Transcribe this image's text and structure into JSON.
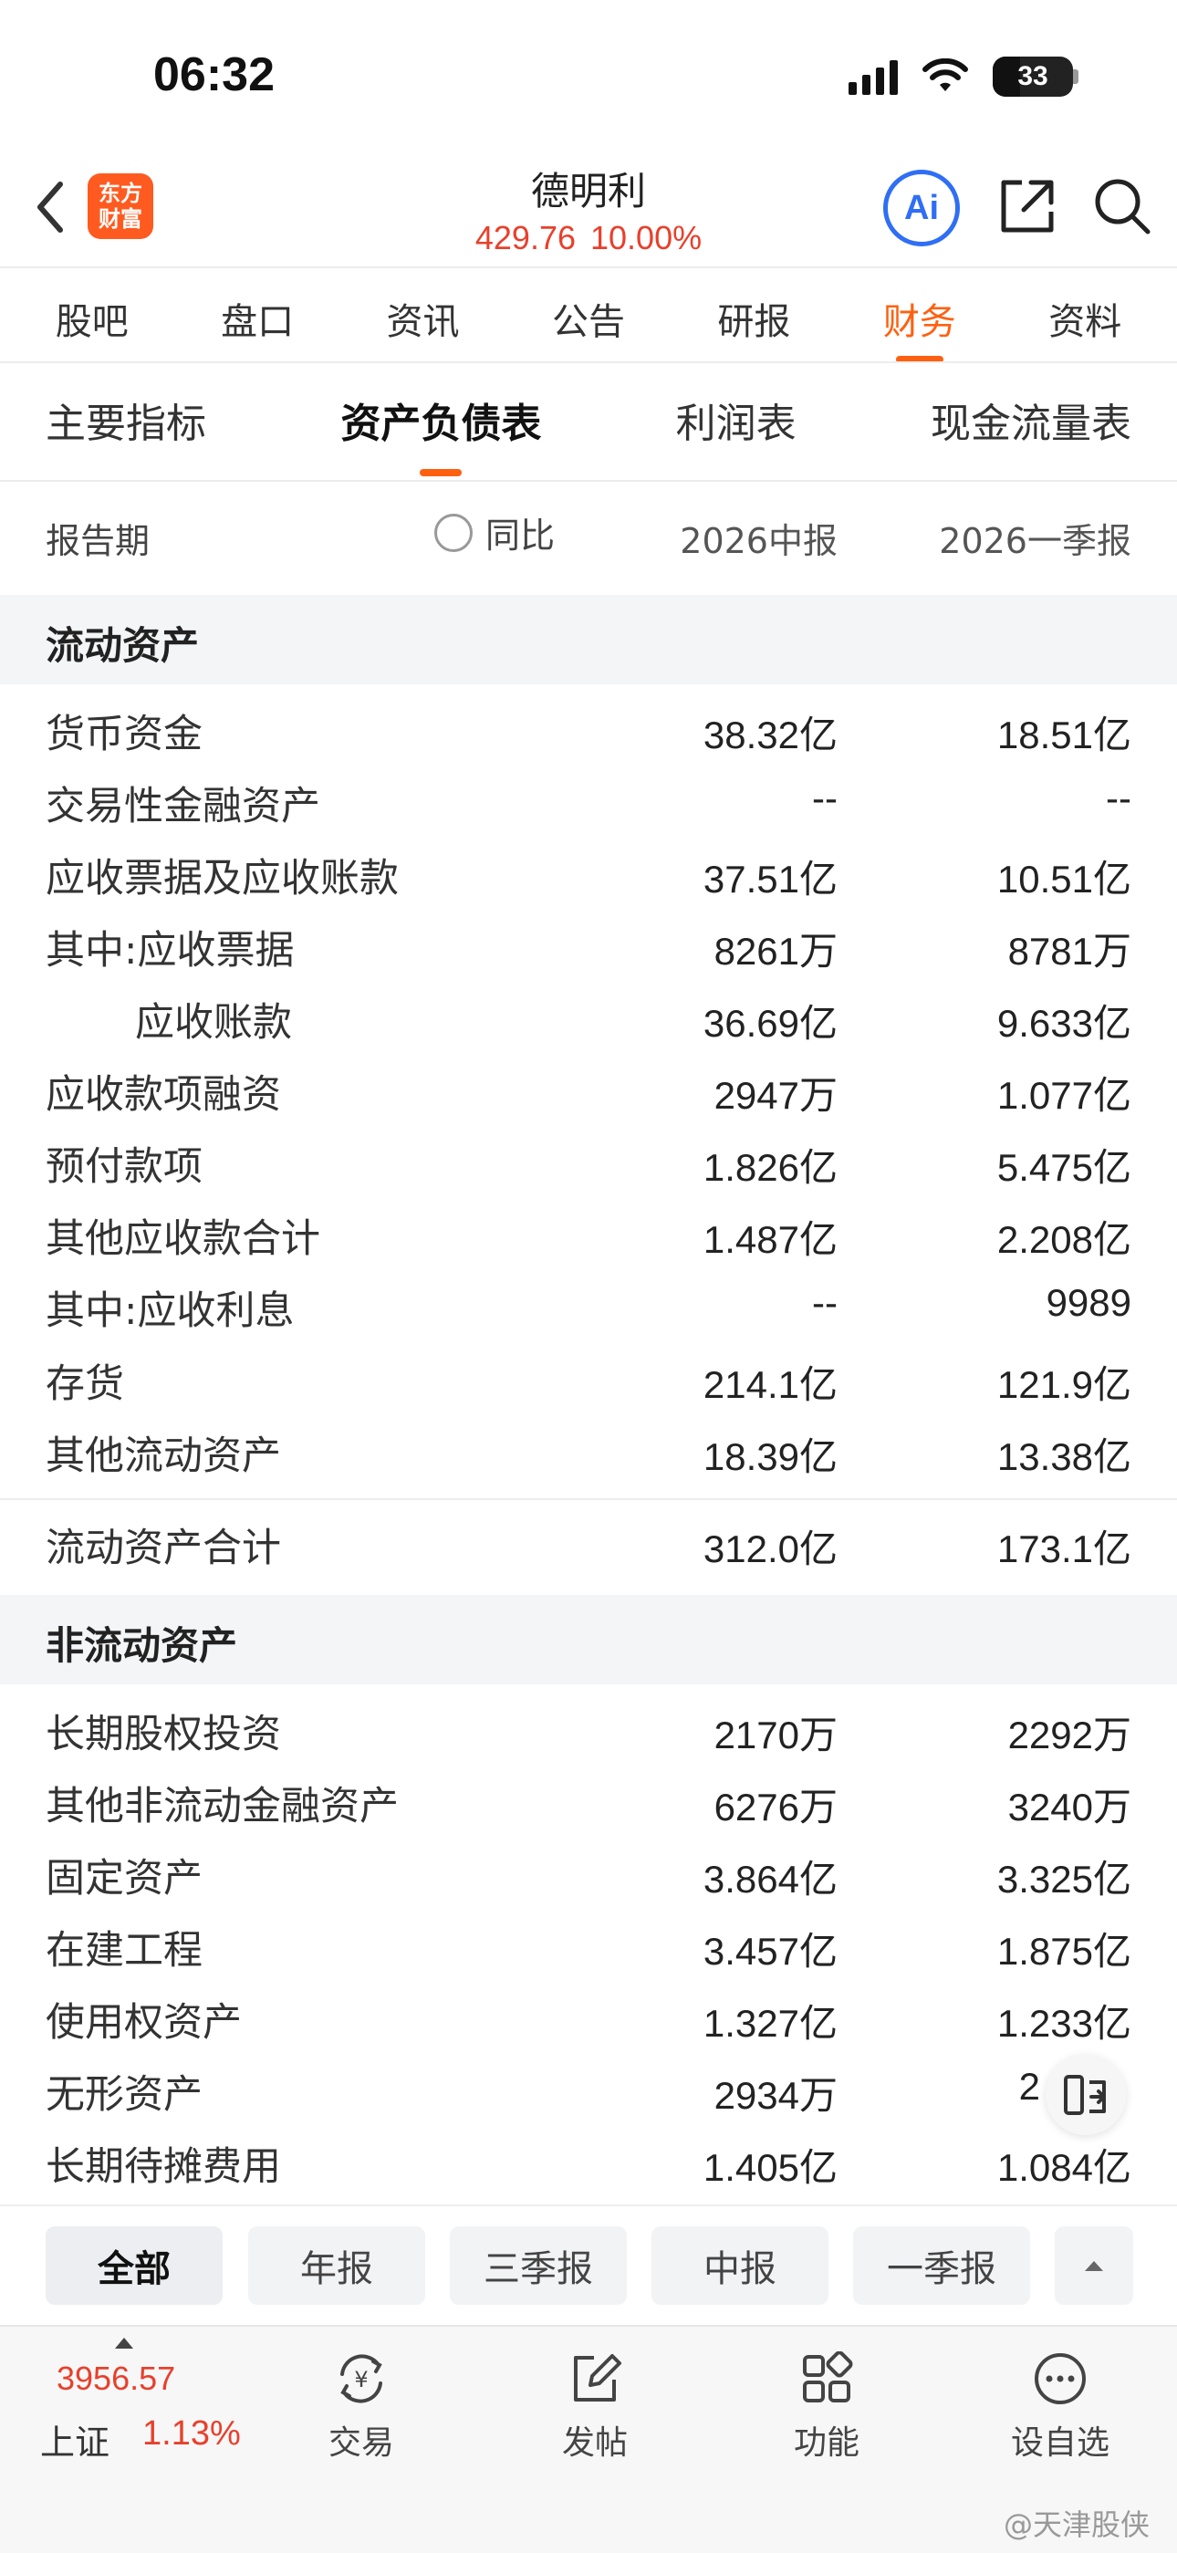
{
  "status": {
    "time": "06:32",
    "battery": "33"
  },
  "header": {
    "logo_line1": "东方",
    "logo_line2": "财富",
    "title": "德明利",
    "price": "429.76",
    "change_pct": "10.00%",
    "ai_label": "Ai"
  },
  "tabs": [
    "股吧",
    "盘口",
    "资讯",
    "公告",
    "研报",
    "财务",
    "资料"
  ],
  "active_tab": "财务",
  "subtabs": [
    "主要指标",
    "资产负债表",
    "利润表",
    "现金流量表"
  ],
  "active_subtab": "资产负债表",
  "table_header": {
    "period_label": "报告期",
    "yoy_label": "同比",
    "col1": "2026中报",
    "col2": "2026一季报"
  },
  "sections": [
    {
      "title": "流动资产",
      "rows": [
        {
          "label": "货币资金",
          "v1": "38.32亿",
          "v2": "18.51亿"
        },
        {
          "label": "交易性金融资产",
          "v1": "--",
          "v2": "--"
        },
        {
          "label": "应收票据及应收账款",
          "v1": "37.51亿",
          "v2": "10.51亿"
        },
        {
          "label": "其中:应收票据",
          "v1": "8261万",
          "v2": "8781万"
        },
        {
          "label": "应收账款",
          "v1": "36.69亿",
          "v2": "9.633亿",
          "indent": true
        },
        {
          "label": "应收款项融资",
          "v1": "2947万",
          "v2": "1.077亿"
        },
        {
          "label": "预付款项",
          "v1": "1.826亿",
          "v2": "5.475亿"
        },
        {
          "label": "其他应收款合计",
          "v1": "1.487亿",
          "v2": "2.208亿"
        },
        {
          "label": "其中:应收利息",
          "v1": "--",
          "v2": "9989"
        },
        {
          "label": "存货",
          "v1": "214.1亿",
          "v2": "121.9亿"
        },
        {
          "label": "其他流动资产",
          "v1": "18.39亿",
          "v2": "13.38亿"
        }
      ],
      "total": {
        "label": "流动资产合计",
        "v1": "312.0亿",
        "v2": "173.1亿"
      }
    },
    {
      "title": "非流动资产",
      "rows": [
        {
          "label": "长期股权投资",
          "v1": "2170万",
          "v2": "2292万"
        },
        {
          "label": "其他非流动金融资产",
          "v1": "6276万",
          "v2": "3240万"
        },
        {
          "label": "固定资产",
          "v1": "3.864亿",
          "v2": "3.325亿"
        },
        {
          "label": "在建工程",
          "v1": "3.457亿",
          "v2": "1.875亿"
        },
        {
          "label": "使用权资产",
          "v1": "1.327亿",
          "v2": "1.233亿"
        },
        {
          "label": "无形资产",
          "v1": "2934万",
          "v2": "2"
        },
        {
          "label": "长期待摊费用",
          "v1": "1.405亿",
          "v2": "1.084亿"
        }
      ]
    }
  ],
  "filters": [
    "全部",
    "年报",
    "三季报",
    "中报",
    "一季报"
  ],
  "active_filter": "全部",
  "index": {
    "value": "3956.57",
    "name": "上证",
    "pct": "1.13%"
  },
  "nav": [
    {
      "label": "交易",
      "icon": "yuan-exchange-icon"
    },
    {
      "label": "发帖",
      "icon": "edit-post-icon"
    },
    {
      "label": "功能",
      "icon": "grid-apps-icon"
    },
    {
      "label": "设自选",
      "icon": "more-dots-icon"
    }
  ],
  "watermark": "@天津股侠",
  "colors": {
    "accent": "#ff6010",
    "up_red": "#e8402c",
    "ai_blue": "#2f6ef5"
  }
}
